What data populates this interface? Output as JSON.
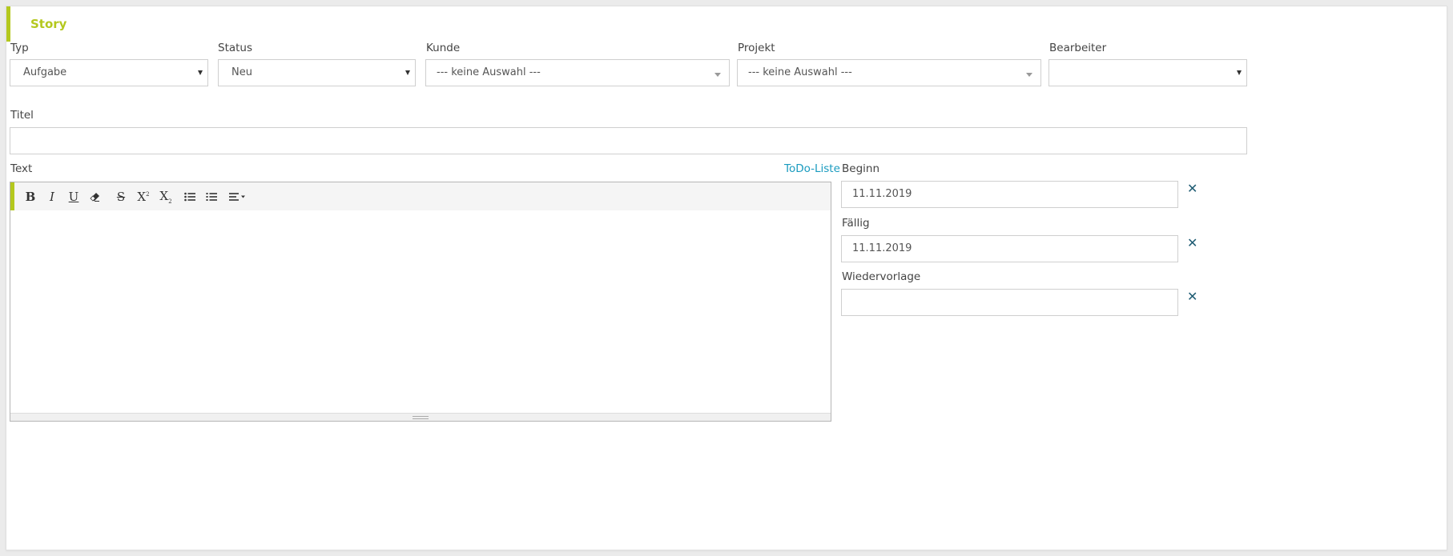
{
  "panel": {
    "title": "Story"
  },
  "fields": {
    "typ": {
      "label": "Typ",
      "value": "Aufgabe"
    },
    "status": {
      "label": "Status",
      "value": "Neu"
    },
    "kunde": {
      "label": "Kunde",
      "value": "--- keine Auswahl ---"
    },
    "projekt": {
      "label": "Projekt",
      "value": "--- keine Auswahl ---"
    },
    "bearbeiter": {
      "label": "Bearbeiter",
      "value": ""
    },
    "titel": {
      "label": "Titel",
      "value": ""
    },
    "text": {
      "label": "Text",
      "todo_link": "ToDo-Liste"
    },
    "beginn": {
      "label": "Beginn",
      "value": "11.11.2019"
    },
    "faellig": {
      "label": "Fällig",
      "value": "11.11.2019"
    },
    "wiedervorlage": {
      "label": "Wiedervorlage",
      "value": ""
    }
  },
  "toolbar": {
    "bold": "B",
    "italic": "I",
    "underline": "U",
    "strike": "S",
    "superscript": "X",
    "subscript": "X"
  },
  "clear_symbol": "✕",
  "colors": {
    "accent": "#b4c81e",
    "link": "#1a9bbf",
    "clear_icon": "#1f5c73"
  }
}
